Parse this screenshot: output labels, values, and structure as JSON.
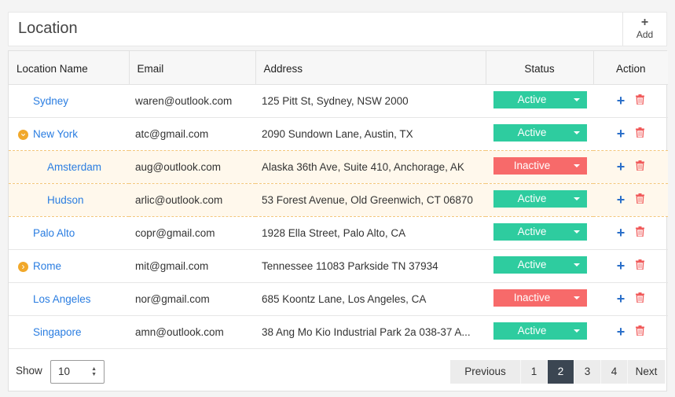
{
  "header": {
    "title": "Location",
    "add_label": "Add"
  },
  "table": {
    "columns": [
      "Location Name",
      "Email",
      "Address",
      "Status",
      "Action"
    ],
    "rows": [
      {
        "name": "Sydney",
        "email": "waren@outlook.com",
        "address": "125 Pitt St, Sydney, NSW 2000",
        "status": "Active",
        "level": 0,
        "expander": "none"
      },
      {
        "name": "New York",
        "email": "atc@gmail.com",
        "address": "2090 Sundown Lane, Austin, TX",
        "status": "Active",
        "level": 0,
        "expander": "expanded"
      },
      {
        "name": "Amsterdam",
        "email": "aug@outlook.com",
        "address": "Alaska 36th Ave, Suite 410, Anchorage, AK",
        "status": "Inactive",
        "level": 1,
        "expander": "none"
      },
      {
        "name": "Hudson",
        "email": "arlic@outlook.com",
        "address": "53 Forest Avenue, Old Greenwich, CT 06870",
        "status": "Active",
        "level": 1,
        "expander": "none"
      },
      {
        "name": "Palo Alto",
        "email": "copr@gmail.com",
        "address": "1928 Ella Street, Palo Alto, CA",
        "status": "Active",
        "level": 0,
        "expander": "none"
      },
      {
        "name": "Rome",
        "email": "mit@gmail.com",
        "address": "Tennessee 11083 Parkside TN 37934",
        "status": "Active",
        "level": 0,
        "expander": "collapsed"
      },
      {
        "name": "Los Angeles",
        "email": "nor@gmail.com",
        "address": "685 Koontz Lane, Los Angeles, CA",
        "status": "Inactive",
        "level": 0,
        "expander": "none"
      },
      {
        "name": "Singapore",
        "email": "amn@outlook.com",
        "address": "38 Ang Mo Kio Industrial Park 2a 038-37 A...",
        "status": "Active",
        "level": 0,
        "expander": "none"
      }
    ]
  },
  "footer": {
    "show_label": "Show",
    "page_size": "10",
    "pagination": {
      "previous": "Previous",
      "pages": [
        "1",
        "2",
        "3",
        "4"
      ],
      "current": "2",
      "next": "Next"
    }
  },
  "colors": {
    "active": "#2ecc9f",
    "inactive": "#f76a6a",
    "link": "#2a7de1",
    "expander": "#f1a82a",
    "child_row_bg": "#fff8ec",
    "delete_icon": "#f15b5b",
    "add_icon": "#2a6fc9",
    "pager_active": "#3b4652"
  },
  "icons": {
    "expanded": "chevron-down-circle-icon",
    "collapsed": "chevron-right-circle-icon",
    "row_add": "plus-icon",
    "row_delete": "trash-icon",
    "header_add": "plus-icon"
  }
}
